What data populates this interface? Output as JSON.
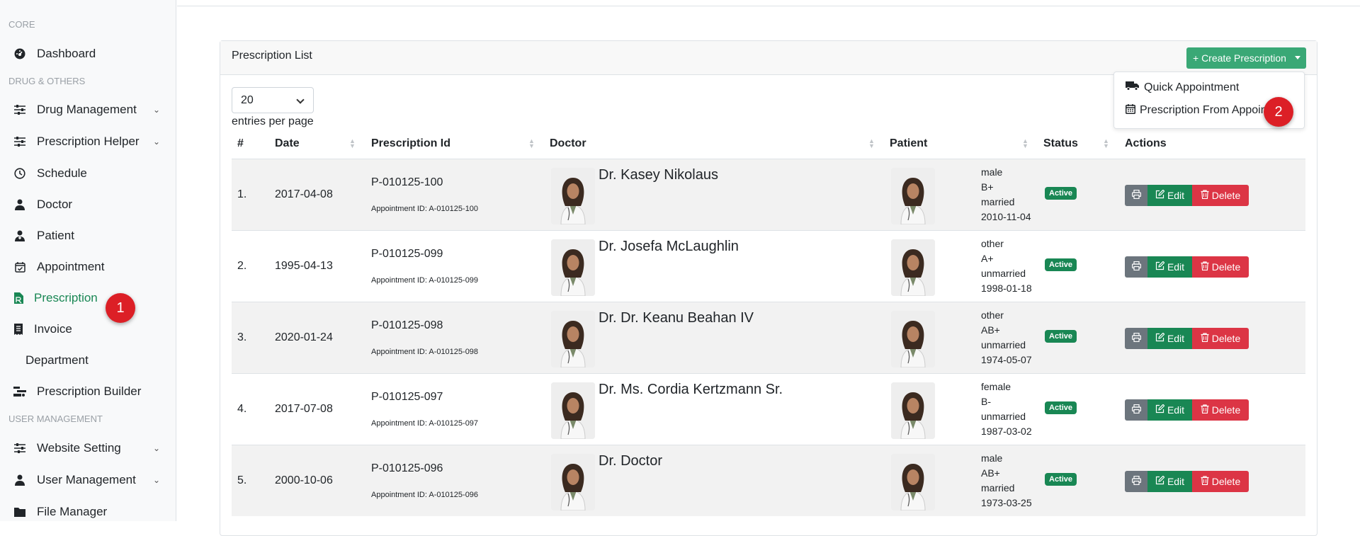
{
  "sidebar": {
    "headings": {
      "core": "CORE",
      "drug": "DRUG & OTHERS",
      "user": "USER MANAGEMENT"
    },
    "items": [
      {
        "label": "Dashboard",
        "icon": "dashboard-icon"
      },
      {
        "label": "Drug Management",
        "icon": "sliders-icon",
        "has_children": true
      },
      {
        "label": "Prescription Helper",
        "icon": "sliders-icon",
        "has_children": true
      },
      {
        "label": "Schedule",
        "icon": "clock-icon"
      },
      {
        "label": "Doctor",
        "icon": "user-doctor-icon"
      },
      {
        "label": "Patient",
        "icon": "patient-icon"
      },
      {
        "label": "Appointment",
        "icon": "calendar-check-icon"
      },
      {
        "label": "Prescription",
        "icon": "file-prescription-icon",
        "active": true
      },
      {
        "label": "Invoice",
        "icon": "receipt-icon"
      },
      {
        "label": "Department",
        "icon": ""
      },
      {
        "label": "Prescription Builder",
        "icon": "builder-icon"
      },
      {
        "label": "Website Setting",
        "icon": "sliders-icon",
        "has_children": true
      },
      {
        "label": "User Management",
        "icon": "user-icon",
        "has_children": true
      },
      {
        "label": "File Manager",
        "icon": "folder-icon"
      }
    ]
  },
  "card": {
    "title": "Prescription List",
    "create_button": "+ Create Prescription"
  },
  "dropdown": {
    "items": [
      {
        "label": "Quick Appointment",
        "icon": "truck-icon"
      },
      {
        "label": "Prescription From Appoin",
        "icon": "calendar-icon"
      }
    ]
  },
  "step_badges": [
    "1",
    "2"
  ],
  "per_page": {
    "value": "20",
    "label": "entries per page"
  },
  "table": {
    "headers": [
      "#",
      "Date",
      "Prescription Id",
      "Doctor",
      "Patient",
      "Status",
      "Actions"
    ],
    "rows": [
      {
        "num": "1.",
        "date": "2017-04-08",
        "pid": "P-010125-100",
        "appt": "Appointment ID: A-010125-100",
        "doctor": "Dr. Kasey Nikolaus",
        "gender": "male",
        "blood": "B+",
        "marital": "married",
        "dob": "2010-11-04",
        "status": "Active"
      },
      {
        "num": "2.",
        "date": "1995-04-13",
        "pid": "P-010125-099",
        "appt": "Appointment ID: A-010125-099",
        "doctor": "Dr. Josefa McLaughlin",
        "gender": "other",
        "blood": "A+",
        "marital": "unmarried",
        "dob": "1998-01-18",
        "status": "Active"
      },
      {
        "num": "3.",
        "date": "2020-01-24",
        "pid": "P-010125-098",
        "appt": "Appointment ID: A-010125-098",
        "doctor": "Dr. Dr. Keanu Beahan IV",
        "gender": "other",
        "blood": "AB+",
        "marital": "unmarried",
        "dob": "1974-05-07",
        "status": "Active"
      },
      {
        "num": "4.",
        "date": "2017-07-08",
        "pid": "P-010125-097",
        "appt": "Appointment ID: A-010125-097",
        "doctor": "Dr. Ms. Cordia Kertzmann Sr.",
        "gender": "female",
        "blood": "B-",
        "marital": "unmarried",
        "dob": "1987-03-02",
        "status": "Active"
      },
      {
        "num": "5.",
        "date": "2000-10-06",
        "pid": "P-010125-096",
        "appt": "Appointment ID: A-010125-096",
        "doctor": "Dr. Doctor",
        "gender": "male",
        "blood": "AB+",
        "marital": "married",
        "dob": "1973-03-25",
        "status": "Active"
      }
    ],
    "actions": {
      "edit": "Edit",
      "delete": "Delete"
    }
  },
  "colors": {
    "primary": "#198754",
    "create": "#3aa876",
    "danger": "#dc3545",
    "print": "#6c757d",
    "badge": "#dc1f26"
  }
}
